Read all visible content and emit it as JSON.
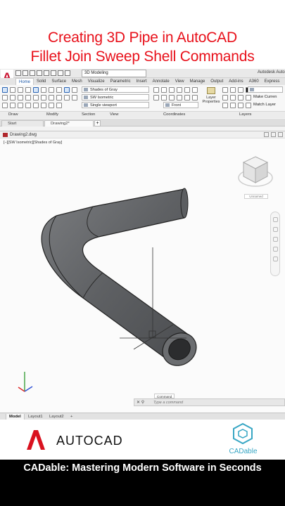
{
  "banner": {
    "line1": "Creating 3D Pipe in AutoCAD",
    "line2": "Fillet Join Sweep Shell Commands"
  },
  "app": {
    "icon_letter": "A",
    "workspace": "3D Modeling",
    "title": "Autodesk Auto",
    "ribbon_tabs": [
      "Home",
      "Solid",
      "Surface",
      "Mesh",
      "Visualize",
      "Parametric",
      "Insert",
      "Annotate",
      "View",
      "Manage",
      "Output",
      "Add-ins",
      "A360",
      "Express"
    ],
    "active_tab": "Home",
    "view_panel": {
      "visual_style": "Shades of Gray",
      "view_direction": "SW Isometric",
      "viewport_config": "Single viewport"
    },
    "coordinates_panel": {
      "ucs_view": "Front"
    },
    "layers_panel": {
      "layer_value": "0",
      "layer_properties_label": "Layer Properties",
      "make_current": "Make Curren",
      "match_layer": "Match Layer"
    },
    "panel_labels": [
      "Draw",
      "Modify",
      "Section",
      "View",
      "Coordinates",
      "Layers"
    ],
    "doc_tabs": [
      "Start",
      "Drawing2*"
    ],
    "drawing_title": "Drawing2.dwg",
    "viewport_label": "[−][SW Isometric][Shades of Gray]",
    "viewcube_label": "Unnamed",
    "command_label": "Command",
    "command_placeholder": "Type a command",
    "layout_tabs": [
      "Model",
      "Layout1",
      "Layout2"
    ],
    "colors": {
      "accent": "#1b57a6",
      "pipe": "#5f6164"
    }
  },
  "brand": {
    "autocad_letter": "A",
    "autocad_text": "AUTOCAD",
    "cadable_text": "CADable"
  },
  "footer": {
    "text": "CADable: Mastering Modern Software in Seconds"
  }
}
